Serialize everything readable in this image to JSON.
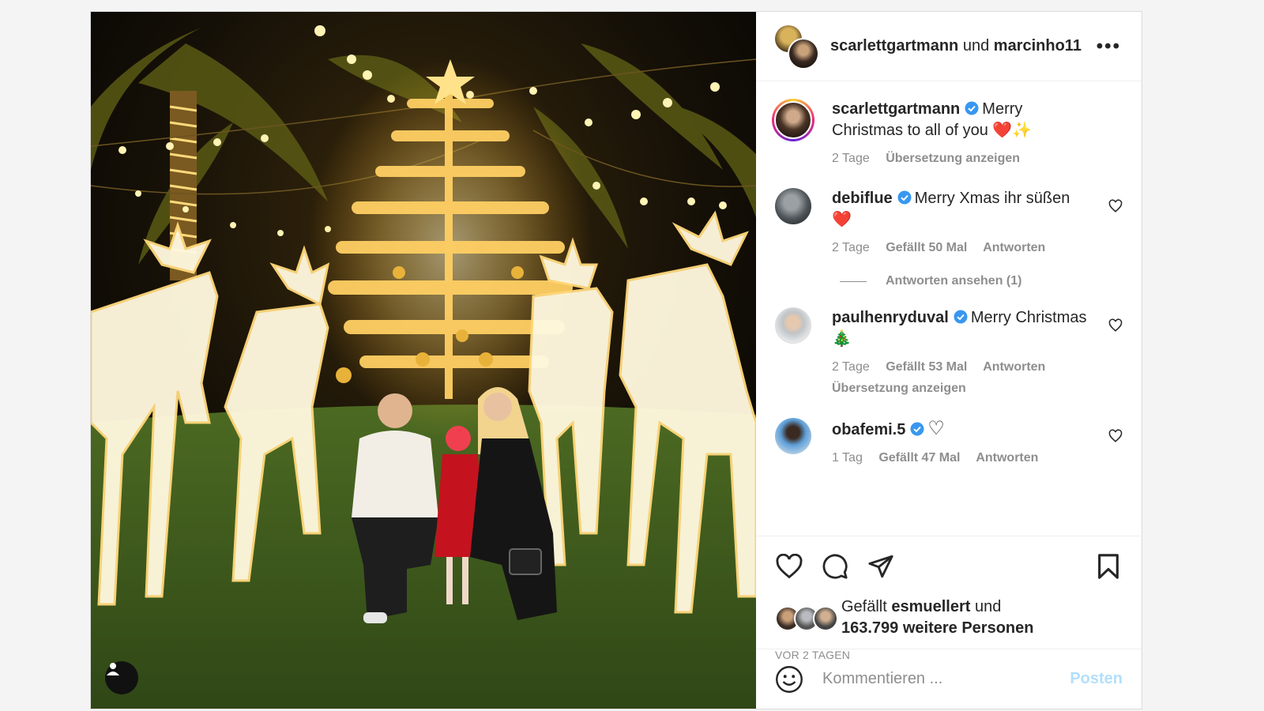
{
  "header": {
    "user1": "scarlettgartmann",
    "joiner": "und",
    "user2": "marcinho11",
    "more_icon": "more-options-icon"
  },
  "caption": {
    "username": "scarlettgartmann",
    "text": "Merry Christmas to all of you",
    "emojis": "❤️✨",
    "time": "2 Tage",
    "translate": "Übersetzung anzeigen"
  },
  "comments": [
    {
      "username": "debiflue",
      "text": "Merry Xmas ihr süßen",
      "emoji": "❤️",
      "time": "2 Tage",
      "likes": "Gefällt 50 Mal",
      "reply": "Antworten",
      "view_replies": "Antworten ansehen (1)"
    },
    {
      "username": "paulhenryduval",
      "text": "Merry Christmas",
      "emoji": "🎄",
      "time": "2 Tage",
      "likes": "Gefällt 53 Mal",
      "reply": "Antworten",
      "translate": "Übersetzung anzeigen"
    },
    {
      "username": "obafemi.5",
      "text": "",
      "emoji": "♡",
      "time": "1 Tag",
      "likes": "Gefällt 47 Mal",
      "reply": "Antworten"
    }
  ],
  "likes": {
    "prefix": "Gefällt",
    "user": "esmuellert",
    "suffix": "und",
    "count_text": "163.799 weitere Personen"
  },
  "posted": "VOR 2 TAGEN",
  "comment_box": {
    "placeholder": "Kommentieren ...",
    "post_label": "Posten"
  },
  "colors": {
    "verified": "#3897f0",
    "link_disabled": "#b2dffc",
    "muted": "#8e8e8e"
  }
}
